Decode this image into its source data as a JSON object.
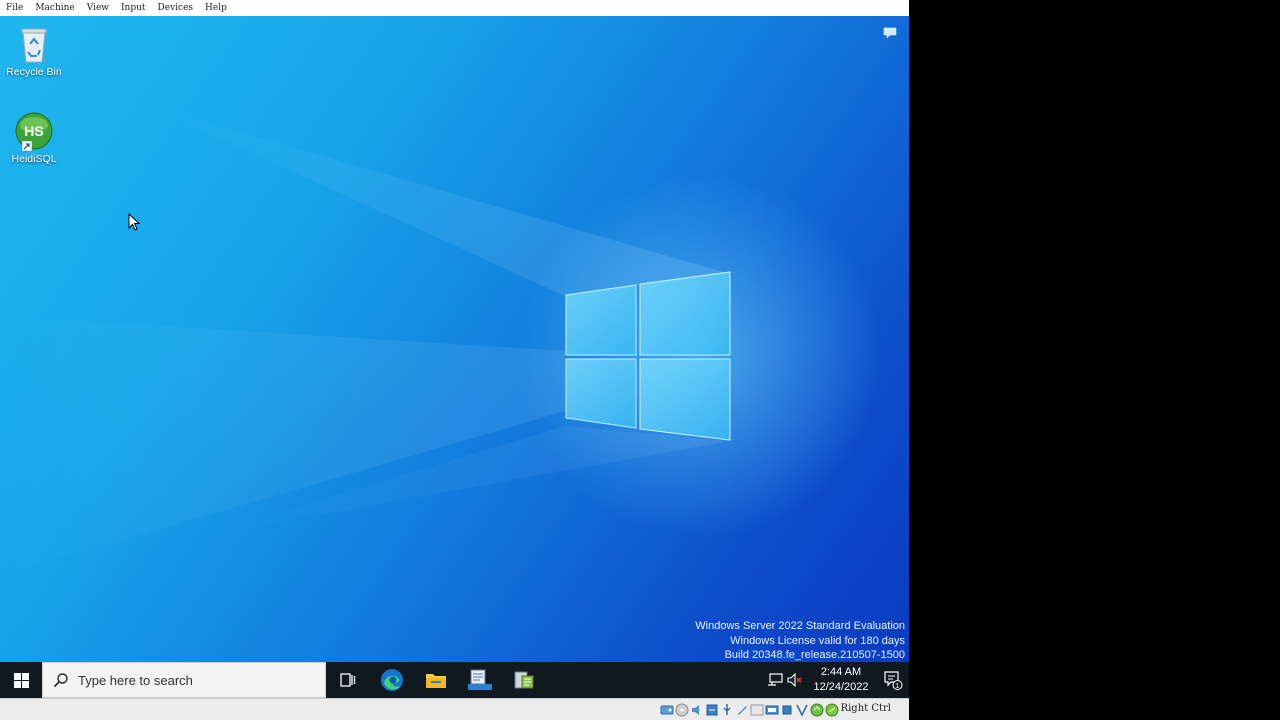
{
  "menubar": {
    "items": [
      "File",
      "Machine",
      "View",
      "Input",
      "Devices",
      "Help"
    ]
  },
  "desktop": {
    "icons": [
      {
        "label": "Recycle Bin",
        "icon": "recycle-bin-icon"
      },
      {
        "label": "HeidiSQL",
        "icon": "heidisql-icon",
        "badge": "HS"
      }
    ],
    "watermark": {
      "line1": "Windows Server 2022 Standard Evaluation",
      "line2": "Windows License valid for 180 days",
      "line3": "Build 20348.fe_release.210507-1500"
    }
  },
  "taskbar": {
    "search_placeholder": "Type here to search",
    "pinned": [
      "task-view-icon",
      "edge-icon",
      "file-explorer-icon",
      "server-manager-icon",
      "tool-icon"
    ],
    "clock": {
      "time": "2:44 AM",
      "date": "12/24/2022"
    },
    "notification_count": "1"
  },
  "statusbar": {
    "host_key": "Right Ctrl"
  },
  "colors": {
    "taskbar": "#101820",
    "desktop_light": "#1fb7ef",
    "desktop_dark": "#0a3cc0"
  }
}
